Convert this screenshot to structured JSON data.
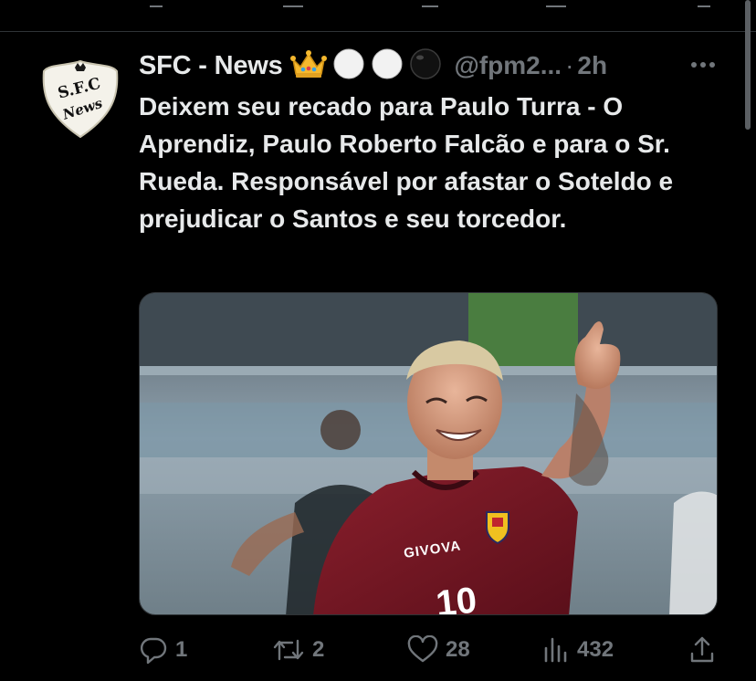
{
  "tweet": {
    "author": {
      "display_name": "SFC - News",
      "handle": "@fpm2...",
      "avatar_text_top": "S.F.C",
      "avatar_text_bottom": "News",
      "badges": [
        "crown-emoji",
        "white-circle-emoji",
        "white-circle-emoji",
        "black-circle-emoji"
      ]
    },
    "separator": "·",
    "time": "2h",
    "text": "Deixem seu recado para Paulo Turra - O Aprendiz, Paulo Roberto Falcão e para o Sr. Rueda. Responsável por afastar o Soteldo e prejudicar o Santos e seu torcedor.",
    "media": {
      "jersey_brand": "GIVOVA",
      "jersey_number": "10",
      "description_icon": "photo"
    },
    "actions": {
      "replies": "1",
      "retweets": "2",
      "likes": "28",
      "views": "432"
    }
  },
  "colors": {
    "background": "#000000",
    "text_primary": "#e7e9ea",
    "text_secondary": "#71767b",
    "divider": "#2f3336"
  }
}
